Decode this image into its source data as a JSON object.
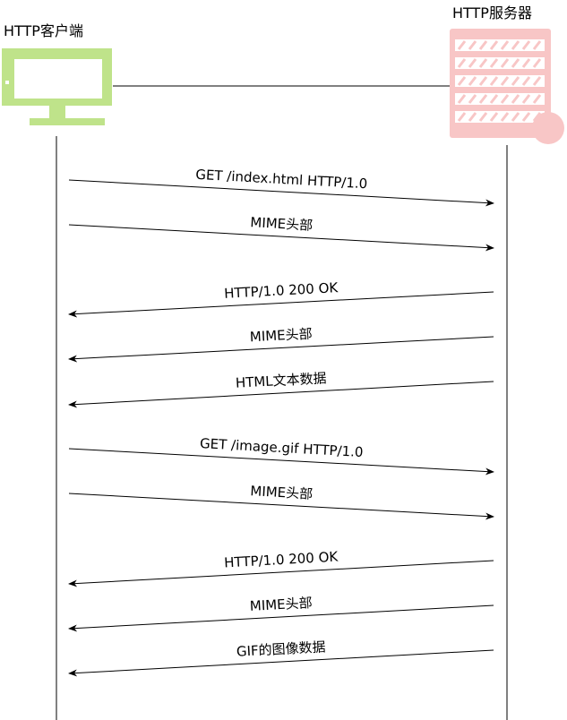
{
  "client": {
    "label": "HTTP客户端",
    "icon": "desktop-computer-icon",
    "color": "#bfe38a"
  },
  "server": {
    "label": "HTTP服务器",
    "icon": "server-rack-icon",
    "color": "#f8c6c6"
  },
  "messages": [
    {
      "label": "GET /index.html HTTP/1.0",
      "direction": "to-server"
    },
    {
      "label": "MIME头部",
      "direction": "to-server"
    },
    {
      "label": "HTTP/1.0 200 OK",
      "direction": "to-client"
    },
    {
      "label": "MIME头部",
      "direction": "to-client"
    },
    {
      "label": "HTML文本数据",
      "direction": "to-client"
    },
    {
      "label": "GET /image.gif HTTP/1.0",
      "direction": "to-server"
    },
    {
      "label": "MIME头部",
      "direction": "to-server"
    },
    {
      "label": "HTTP/1.0 200 OK",
      "direction": "to-client"
    },
    {
      "label": "MIME头部",
      "direction": "to-client"
    },
    {
      "label": "GIF的图像数据",
      "direction": "to-client"
    }
  ]
}
